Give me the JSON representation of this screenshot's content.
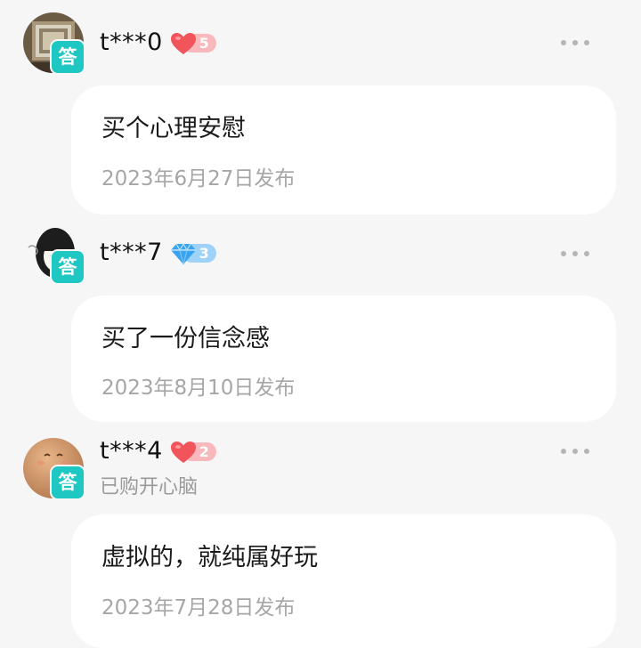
{
  "answer_badge": "答",
  "answers": [
    {
      "username": "t***0",
      "level_type": "heart",
      "level": "5",
      "purchased": "",
      "content": "买个心理安慰",
      "date": "2023年6月27日发布"
    },
    {
      "username": "t***7",
      "level_type": "diamond",
      "level": "3",
      "purchased": "",
      "content": "买了一份信念感",
      "date": "2023年8月10日发布"
    },
    {
      "username": "t***4",
      "level_type": "heart",
      "level": "2",
      "purchased": "已购开心脑",
      "content": "虚拟的，就纯属好玩",
      "date": "2023年7月28日发布"
    }
  ],
  "colors": {
    "badge": "#1ec7c2",
    "heart": "#f2545b",
    "heart_pill": "#f8b8bc",
    "diamond": "#3aa3f0",
    "diamond_pill": "#9ed2f8"
  },
  "icons": {
    "more": "more-dots-icon",
    "heart": "heart-icon",
    "diamond": "diamond-icon"
  }
}
